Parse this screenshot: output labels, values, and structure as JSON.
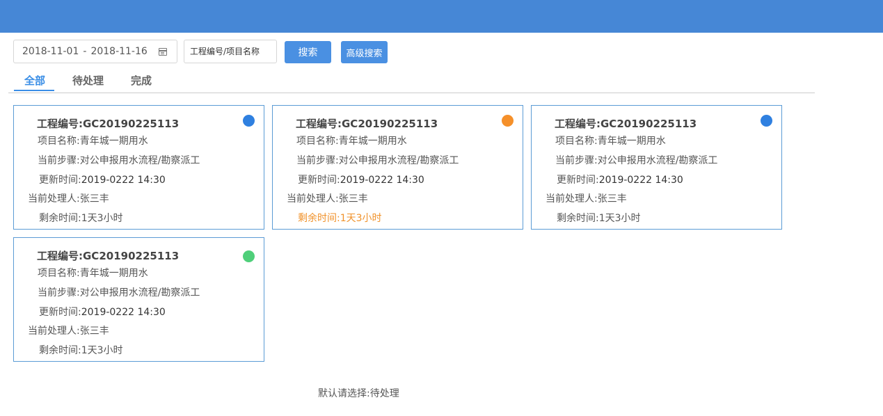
{
  "search": {
    "date_start": "2018-11-01",
    "date_sep": "-",
    "date_end": "2018-11-16",
    "keyword_placeholder": "工程编号/项目名称",
    "search_label": "搜索",
    "advanced_label": "高级搜索"
  },
  "tabs": [
    {
      "label": "全部",
      "active": true
    },
    {
      "label": "待处理",
      "active": false
    },
    {
      "label": "完成",
      "active": false
    }
  ],
  "cards": [
    {
      "code_label": "工程编号:",
      "code": "GC20190225113",
      "project_label": "项目名称:",
      "project": "青年城一期用水",
      "step_label": "当前步骤:",
      "step": "对公申报用水流程/勘察派工",
      "updated_label": "更新时间:",
      "updated": "2019-0222 14:30",
      "handler_label": "当前处理人:",
      "handler": "张三丰",
      "remaining_label": "剩余时间:",
      "remaining": "1天3小时",
      "status_color": "#2f80e0",
      "remaining_warn": false
    },
    {
      "code_label": "工程编号:",
      "code": "GC20190225113",
      "project_label": "项目名称:",
      "project": "青年城一期用水",
      "step_label": "当前步骤:",
      "step": "对公申报用水流程/勘察派工",
      "updated_label": "更新时间:",
      "updated": "2019-0222 14:30",
      "handler_label": "当前处理人:",
      "handler": "张三丰",
      "remaining_label": "剩余时间:",
      "remaining": "1天3小时",
      "status_color": "#f5902a",
      "remaining_warn": true
    },
    {
      "code_label": "工程编号:",
      "code": "GC20190225113",
      "project_label": "项目名称:",
      "project": "青年城一期用水",
      "step_label": "当前步骤:",
      "step": "对公申报用水流程/勘察派工",
      "updated_label": "更新时间:",
      "updated": "2019-0222 14:30",
      "handler_label": "当前处理人:",
      "handler": "张三丰",
      "remaining_label": "剩余时间:",
      "remaining": "1天3小时",
      "status_color": "#2f80e0",
      "remaining_warn": false
    },
    {
      "code_label": "工程编号:",
      "code": "GC20190225113",
      "project_label": "项目名称:",
      "project": "青年城一期用水",
      "step_label": "当前步骤:",
      "step": "对公申报用水流程/勘察派工",
      "updated_label": "更新时间:",
      "updated": "2019-0222 14:30",
      "handler_label": "当前处理人:",
      "handler": "张三丰",
      "remaining_label": "剩余时间:",
      "remaining": "1天3小时",
      "status_color": "#4fcf7a",
      "remaining_warn": false
    }
  ],
  "footer_note": "默认请选择:待处理",
  "colors": {
    "topbar": "#4687d6",
    "accent": "#3a8ee6",
    "card_border": "#5b9bd5"
  }
}
